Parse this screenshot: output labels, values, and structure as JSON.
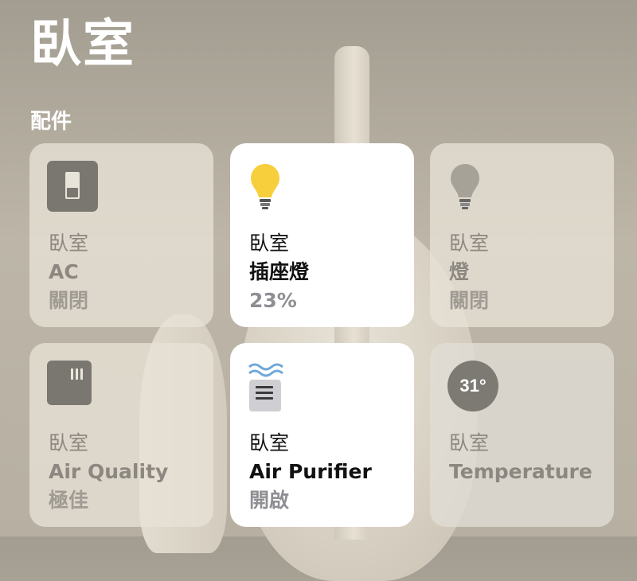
{
  "page": {
    "title": "臥室",
    "section": "配件"
  },
  "tiles": [
    {
      "room": "臥室",
      "name": "AC",
      "status": "關閉",
      "icon": "switch-icon",
      "state": "off"
    },
    {
      "room": "臥室",
      "name": "插座燈",
      "status": "23%",
      "icon": "lightbulb-on-icon",
      "state": "on",
      "brightness": 0.23
    },
    {
      "room": "臥室",
      "name": "燈",
      "status": "關閉",
      "icon": "lightbulb-off-icon",
      "state": "off"
    },
    {
      "room": "臥室",
      "name": "Air Quality",
      "status": "極佳",
      "icon": "air-quality-sensor-icon",
      "state": "off"
    },
    {
      "room": "臥室",
      "name": "Air Purifier",
      "status": "開啟",
      "icon": "air-purifier-icon",
      "state": "on"
    },
    {
      "room": "臥室",
      "name": "Temperature",
      "icon": "temperature-badge-icon",
      "state": "off",
      "reading": "31°"
    }
  ],
  "colors": {
    "bulb_on": "#f7cf3c",
    "bulb_off": "#a7a297",
    "device_icon": "#7a7670",
    "purifier_waves": "#6fa8d8",
    "tile_on": "#ffffff"
  }
}
